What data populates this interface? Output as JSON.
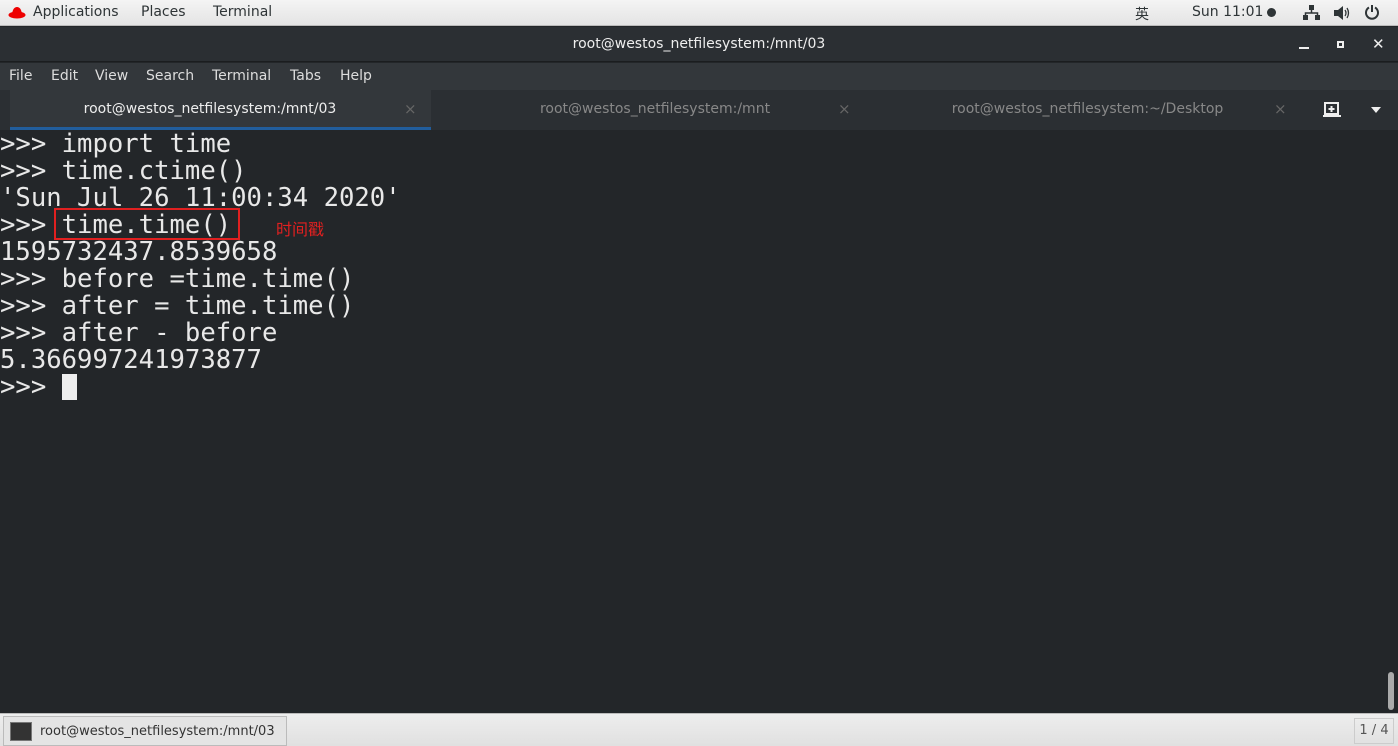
{
  "topbar": {
    "applications": "Applications",
    "places": "Places",
    "terminal": "Terminal",
    "input_method": "英",
    "clock": "Sun 11:01"
  },
  "window": {
    "title": "root@westos_netfilesystem:/mnt/03"
  },
  "menu": [
    "File",
    "Edit",
    "View",
    "Search",
    "Terminal",
    "Tabs",
    "Help"
  ],
  "tabs": [
    {
      "label": "root@westos_netfilesystem:/mnt/03",
      "active": true
    },
    {
      "label": "root@westos_netfilesystem:/mnt"
    },
    {
      "label": "root@westos_netfilesystem:~/Desktop"
    }
  ],
  "terminal": {
    "lines": [
      ">>> import time",
      ">>> time.ctime()",
      "'Sun Jul 26 11:00:34 2020'",
      ">>> time.time()",
      "1595732437.8539658",
      ">>> before =time.time()",
      ">>> after = time.time()",
      ">>> after - before",
      "5.366997241973877"
    ],
    "prompt": ">>> "
  },
  "annotation": {
    "text": "时间戳",
    "color": "#e02020"
  },
  "taskbar": {
    "task": "root@westos_netfilesystem:/mnt/03",
    "workspace": "1 / 4"
  }
}
